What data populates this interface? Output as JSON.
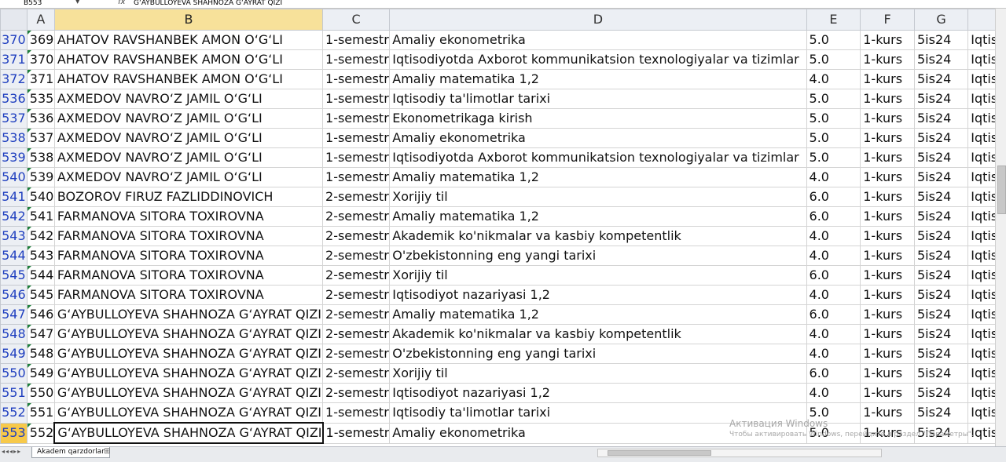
{
  "formula_bar": {
    "name_box": "B553",
    "fx_symbol": "fx",
    "formula": "G‘AYBULLOYEVA SHAHNOZA G‘AYRAT QIZI"
  },
  "columns": [
    "A",
    "B",
    "C",
    "D",
    "E",
    "F",
    "G"
  ],
  "selected_column": "B",
  "rows": [
    {
      "row": "370",
      "a": "369",
      "b": "AHATOV RAVSHANBEK AMON O‘G‘LI",
      "c": "1-semestr",
      "d": "Amaliy ekonometrika",
      "e": "5.0",
      "f": "1-kurs",
      "g": "5is24",
      "h": "Iqtiso"
    },
    {
      "row": "371",
      "a": "370",
      "b": "AHATOV RAVSHANBEK AMON O‘G‘LI",
      "c": "1-semestr",
      "d": "Iqtisodiyotda Axborot kommunikatsion texnologiyalar va tizimlar",
      "e": "5.0",
      "f": "1-kurs",
      "g": "5is24",
      "h": "Iqtiso"
    },
    {
      "row": "372",
      "a": "371",
      "b": "AHATOV RAVSHANBEK AMON O‘G‘LI",
      "c": "1-semestr",
      "d": "Amaliy matematika 1,2",
      "e": "4.0",
      "f": "1-kurs",
      "g": "5is24",
      "h": "Iqtiso"
    },
    {
      "row": "536",
      "a": "535",
      "b": "AXMEDOV NAVRO‘Z JAMIL O‘G‘LI",
      "c": "1-semestr",
      "d": "Iqtisodiy ta'limotlar tarixi",
      "e": "5.0",
      "f": "1-kurs",
      "g": "5is24",
      "h": "Iqtiso"
    },
    {
      "row": "537",
      "a": "536",
      "b": "AXMEDOV NAVRO‘Z JAMIL O‘G‘LI",
      "c": "1-semestr",
      "d": "Ekonometrikaga kirish",
      "e": "5.0",
      "f": "1-kurs",
      "g": "5is24",
      "h": "Iqtiso"
    },
    {
      "row": "538",
      "a": "537",
      "b": "AXMEDOV NAVRO‘Z JAMIL O‘G‘LI",
      "c": "1-semestr",
      "d": "Amaliy ekonometrika",
      "e": "5.0",
      "f": "1-kurs",
      "g": "5is24",
      "h": "Iqtiso"
    },
    {
      "row": "539",
      "a": "538",
      "b": "AXMEDOV NAVRO‘Z JAMIL O‘G‘LI",
      "c": "1-semestr",
      "d": "Iqtisodiyotda Axborot kommunikatsion texnologiyalar va tizimlar",
      "e": "5.0",
      "f": "1-kurs",
      "g": "5is24",
      "h": "Iqtiso"
    },
    {
      "row": "540",
      "a": "539",
      "b": "AXMEDOV NAVRO‘Z JAMIL O‘G‘LI",
      "c": "1-semestr",
      "d": "Amaliy matematika 1,2",
      "e": "4.0",
      "f": "1-kurs",
      "g": "5is24",
      "h": "Iqtiso"
    },
    {
      "row": "541",
      "a": "540",
      "b": "BOZOROV FIRUZ FAZLIDDINOVICH",
      "c": "2-semestr",
      "d": "Xorijiy til",
      "e": "6.0",
      "f": "1-kurs",
      "g": "5is24",
      "h": "Iqtiso"
    },
    {
      "row": "542",
      "a": "541",
      "b": "FARMANOVA SITORA TOXIROVNA",
      "c": "2-semestr",
      "d": "Amaliy matematika 1,2",
      "e": "6.0",
      "f": "1-kurs",
      "g": "5is24",
      "h": "Iqtiso"
    },
    {
      "row": "543",
      "a": "542",
      "b": "FARMANOVA SITORA TOXIROVNA",
      "c": "2-semestr",
      "d": "Akademik ko'nikmalar va kasbiy kompetentlik",
      "e": "4.0",
      "f": "1-kurs",
      "g": "5is24",
      "h": "Iqtiso"
    },
    {
      "row": "544",
      "a": "543",
      "b": "FARMANOVA SITORA TOXIROVNA",
      "c": "2-semestr",
      "d": "O'zbekistonning eng yangi tarixi",
      "e": "4.0",
      "f": "1-kurs",
      "g": "5is24",
      "h": "Iqtiso"
    },
    {
      "row": "545",
      "a": "544",
      "b": "FARMANOVA SITORA TOXIROVNA",
      "c": "2-semestr",
      "d": "Xorijiy til",
      "e": "6.0",
      "f": "1-kurs",
      "g": "5is24",
      "h": "Iqtiso"
    },
    {
      "row": "546",
      "a": "545",
      "b": "FARMANOVA SITORA TOXIROVNA",
      "c": "2-semestr",
      "d": "Iqtisodiyot nazariyasi 1,2",
      "e": "4.0",
      "f": "1-kurs",
      "g": "5is24",
      "h": "Iqtiso"
    },
    {
      "row": "547",
      "a": "546",
      "b": "G‘AYBULLOYEVA SHAHNOZA G‘AYRAT QIZI",
      "c": "2-semestr",
      "d": "Amaliy matematika 1,2",
      "e": "6.0",
      "f": "1-kurs",
      "g": "5is24",
      "h": "Iqtiso"
    },
    {
      "row": "548",
      "a": "547",
      "b": "G‘AYBULLOYEVA SHAHNOZA G‘AYRAT QIZI",
      "c": "2-semestr",
      "d": "Akademik ko'nikmalar va kasbiy kompetentlik",
      "e": "4.0",
      "f": "1-kurs",
      "g": "5is24",
      "h": "Iqtiso"
    },
    {
      "row": "549",
      "a": "548",
      "b": "G‘AYBULLOYEVA SHAHNOZA G‘AYRAT QIZI",
      "c": "2-semestr",
      "d": "O'zbekistonning eng yangi tarixi",
      "e": "4.0",
      "f": "1-kurs",
      "g": "5is24",
      "h": "Iqtiso"
    },
    {
      "row": "550",
      "a": "549",
      "b": "G‘AYBULLOYEVA SHAHNOZA G‘AYRAT QIZI",
      "c": "2-semestr",
      "d": "Xorijiy til",
      "e": "6.0",
      "f": "1-kurs",
      "g": "5is24",
      "h": "Iqtiso"
    },
    {
      "row": "551",
      "a": "550",
      "b": "G‘AYBULLOYEVA SHAHNOZA G‘AYRAT QIZI",
      "c": "2-semestr",
      "d": "Iqtisodiyot nazariyasi 1,2",
      "e": "4.0",
      "f": "1-kurs",
      "g": "5is24",
      "h": "Iqtiso"
    },
    {
      "row": "552",
      "a": "551",
      "b": "G‘AYBULLOYEVA SHAHNOZA G‘AYRAT QIZI",
      "c": "1-semestr",
      "d": "Iqtisodiy ta'limotlar tarixi",
      "e": "5.0",
      "f": "1-kurs",
      "g": "5is24",
      "h": "Iqtiso"
    },
    {
      "row": "553",
      "a": "552",
      "b": "G‘AYBULLOYEVA SHAHNOZA G‘AYRAT QIZI",
      "c": "1-semestr",
      "d": "Amaliy ekonometrika",
      "e": "5.0",
      "f": "1-kurs",
      "g": "5is24",
      "h": "Iqtiso"
    }
  ],
  "active_row": "553",
  "sheet_tabs": [
    "Akadem qarzdorlar"
  ],
  "watermark": {
    "line1": "Активация Windows",
    "line2": "Чтобы активировать Windows, перейдите в раздел \"Параметры\"."
  },
  "colors": {
    "header_bg": "#eceff4",
    "selected_header": "#f7e19a",
    "row_number": "#1f3fbf",
    "cell_indicator": "#1e7f3c"
  }
}
